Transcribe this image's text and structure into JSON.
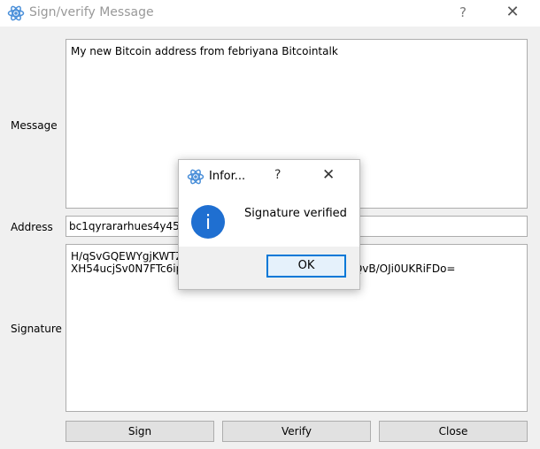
{
  "window": {
    "title": "Sign/verify Message",
    "help_glyph": "?",
    "close_glyph": "✕"
  },
  "form": {
    "message_label": "Message",
    "message_value": "My new Bitcoin address from febriyana Bitcointalk",
    "address_label": "Address",
    "address_value": "bc1qyrararhues4y45dv",
    "signature_label": "Signature",
    "signature_line1": "H/qSvGQEWYgjKWTZ",
    "signature_line2_start": "XH54ucjSv0N7FTc6ip",
    "signature_line2_end": "5QvB/OJi0UKRiFDo="
  },
  "buttons": {
    "sign": "Sign",
    "verify": "Verify",
    "close": "Close"
  },
  "dialog": {
    "title": "Infor...",
    "help_glyph": "?",
    "close_glyph": "✕",
    "info_glyph": "i",
    "message": "Signature verified",
    "ok": "OK"
  },
  "colors": {
    "info_icon": "#1f6fd1",
    "ok_border": "#0078d7",
    "app_icon": "#4a8fd9"
  },
  "icons": {
    "app": "electrum-atom-icon",
    "info": "info-icon"
  }
}
